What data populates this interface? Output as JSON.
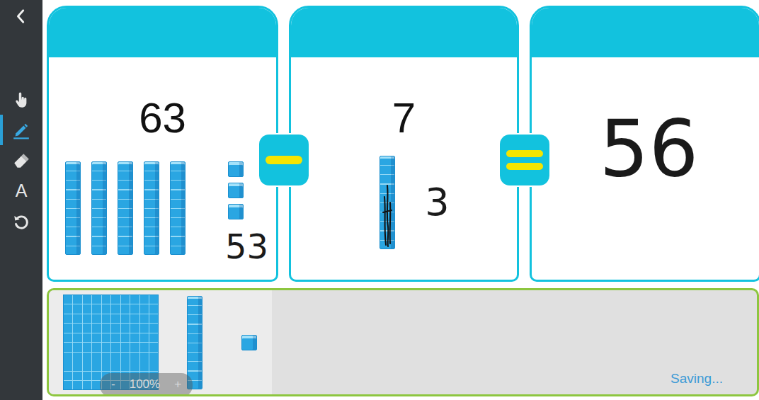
{
  "tools": [
    {
      "kind": "pointer",
      "selected": false
    },
    {
      "kind": "pen",
      "selected": true
    },
    {
      "kind": "eraser",
      "selected": false
    },
    {
      "kind": "text",
      "label": "A",
      "selected": false
    },
    {
      "kind": "undo",
      "selected": false
    }
  ],
  "cards": [
    {
      "kind": "problem",
      "number": "63",
      "tens": 5,
      "ones": 3,
      "crossed_tens": 0,
      "handwriting": "53"
    },
    {
      "kind": "subtrahend",
      "number": "7",
      "tens": 1,
      "ones": 0,
      "crossed_tens": 1,
      "handwriting": "3"
    },
    {
      "kind": "answer",
      "tens": 0,
      "ones": 0,
      "crossed_tens": 0,
      "handwriting": "56"
    }
  ],
  "operators": [
    {
      "kind": "minus"
    },
    {
      "kind": "equals"
    }
  ],
  "tray": {
    "pieces": [
      {
        "kind": "hundred"
      },
      {
        "kind": "ten"
      },
      {
        "kind": "one"
      }
    ],
    "zoom": {
      "minus": "-",
      "value": "100%",
      "plus": "+"
    },
    "status": "Saving..."
  }
}
